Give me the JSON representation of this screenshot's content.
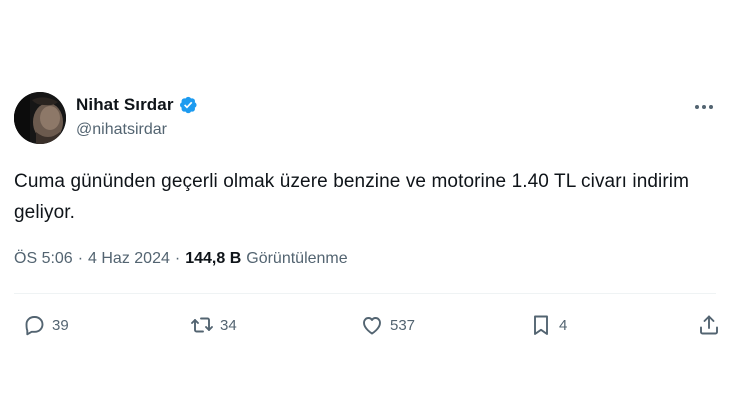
{
  "author": {
    "name": "Nihat Sırdar",
    "handle": "@nihatsirdar"
  },
  "tweet": {
    "text": "Cuma gününden geçerli olmak üzere benzine ve motorine 1.40 TL civarı indirim geliyor."
  },
  "meta": {
    "time": "ÖS 5:06",
    "separator_1": "·",
    "date": "4 Haz 2024",
    "separator_2": "·",
    "views": "144,8 B",
    "views_label": "Görüntülenme"
  },
  "actions": {
    "replies": "39",
    "reposts": "34",
    "likes": "537",
    "bookmarks": "4"
  },
  "icons": {
    "verified": "verified-badge-icon",
    "more": "more-dots-icon",
    "reply": "reply-bubble-icon",
    "repost": "repost-arrows-icon",
    "like": "heart-icon",
    "bookmark": "bookmark-icon",
    "share": "share-upload-icon"
  },
  "colors": {
    "verified": "#1d9bf0",
    "text_primary": "#0f1419",
    "text_secondary": "#536471",
    "divider": "#eff3f4"
  }
}
